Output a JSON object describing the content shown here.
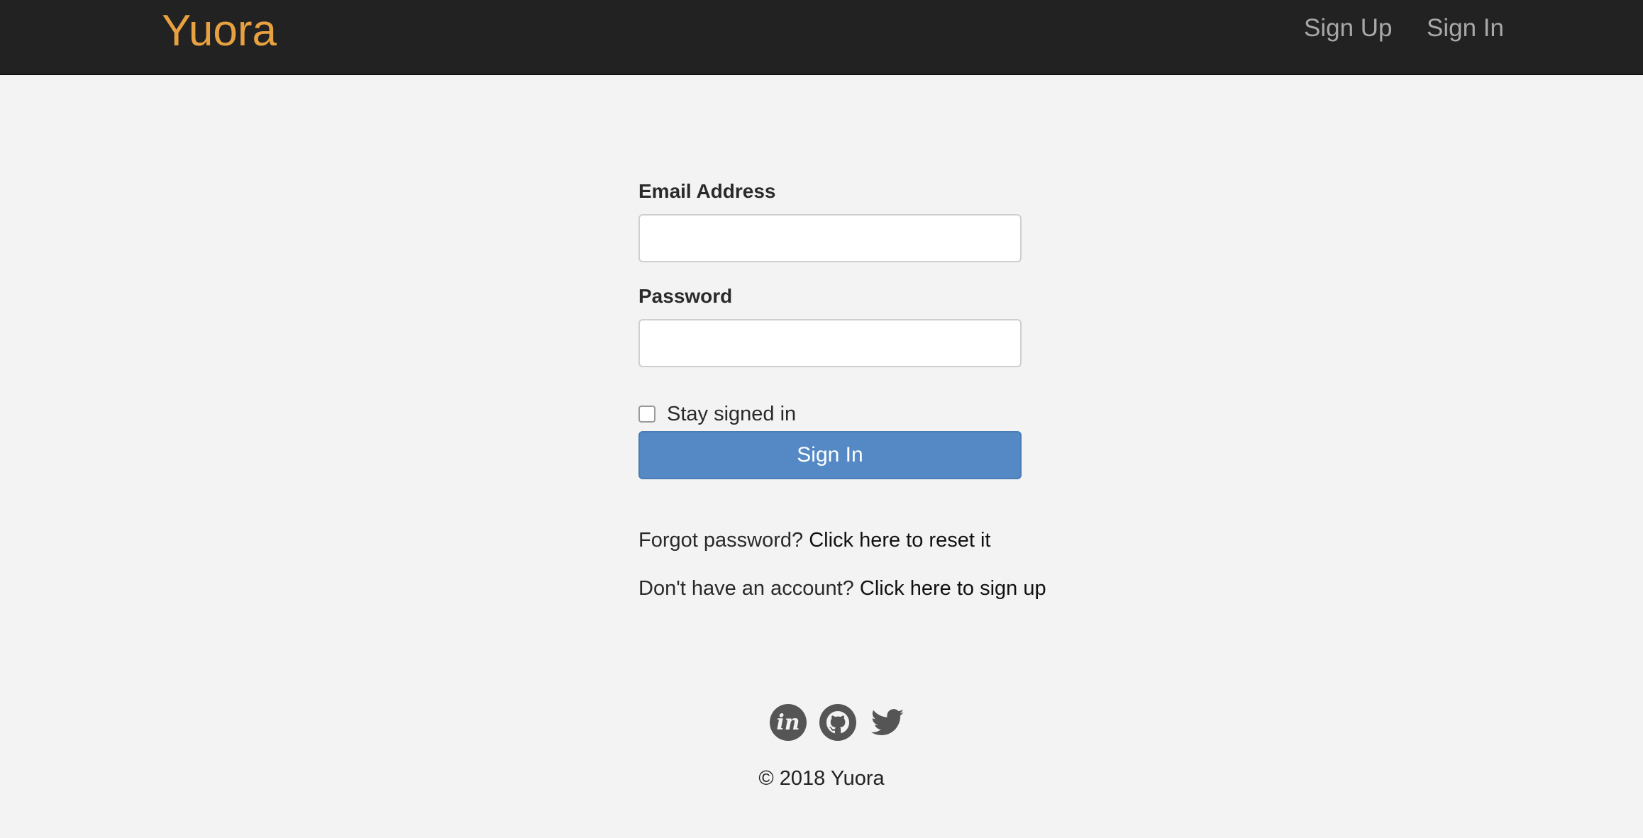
{
  "brand": {
    "name": "Yuora",
    "color": "#e8a140"
  },
  "nav": {
    "sign_up": "Sign Up",
    "sign_in": "Sign In"
  },
  "form": {
    "email_label": "Email Address",
    "email_value": "",
    "password_label": "Password",
    "password_value": "",
    "stay_signed_in_label": "Stay signed in",
    "stay_signed_in_checked": false,
    "submit_label": "Sign In",
    "submit_color": "#5489c6"
  },
  "links": {
    "forgot_prefix": "Forgot password?",
    "forgot_link": "Click here to reset it",
    "signup_prefix": "Don't have an account?",
    "signup_link": "Click here to sign up"
  },
  "footer": {
    "social_icons": [
      "invision-icon",
      "github-icon",
      "twitter-icon"
    ],
    "copyright": "© 2018 Yuora"
  }
}
